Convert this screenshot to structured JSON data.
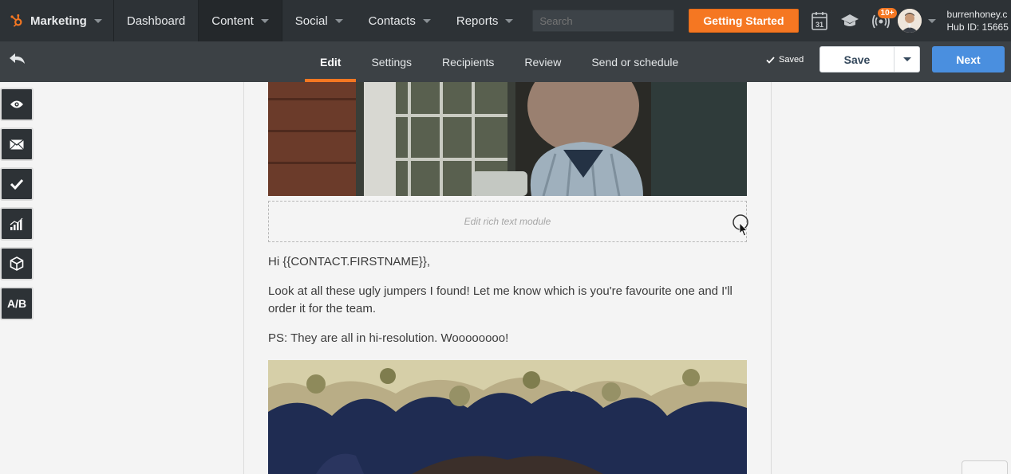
{
  "topnav": {
    "brand": "Marketing",
    "items": [
      {
        "label": "Dashboard",
        "has_caret": false
      },
      {
        "label": "Content",
        "has_caret": true
      },
      {
        "label": "Social",
        "has_caret": true
      },
      {
        "label": "Contacts",
        "has_caret": true
      },
      {
        "label": "Reports",
        "has_caret": true
      }
    ],
    "search_placeholder": "Search",
    "cta_label": "Getting Started",
    "calendar_day": "31",
    "notification_badge": "10+",
    "account_name": "burrenhoney.c",
    "hub_id": "Hub ID: 15665"
  },
  "editbar": {
    "tabs": [
      "Edit",
      "Settings",
      "Recipients",
      "Review",
      "Send or schedule"
    ],
    "active_tab": "Edit",
    "saved_label": "Saved",
    "save_label": "Save",
    "next_label": "Next"
  },
  "rail": {
    "tools": [
      "preview-eye-icon",
      "email-icon",
      "checklist-icon",
      "analytics-icon",
      "module-cube-icon",
      "ab-test-icon"
    ],
    "ab_label": "A/B"
  },
  "email": {
    "rich_text_placeholder": "Edit rich text module",
    "greeting": "Hi {{CONTACT.FIRSTNAME}},",
    "paragraph": "Look at all these ugly jumpers I found! Let me know which is you're favourite one and I'll order it for the team.",
    "ps": "PS: They are all in hi-resolution. Woooooooo!"
  },
  "colors": {
    "nav_bg": "#2d3236",
    "editbar_bg": "#3c4145",
    "accent_orange": "#f57722",
    "next_blue": "#4a8fdf"
  }
}
